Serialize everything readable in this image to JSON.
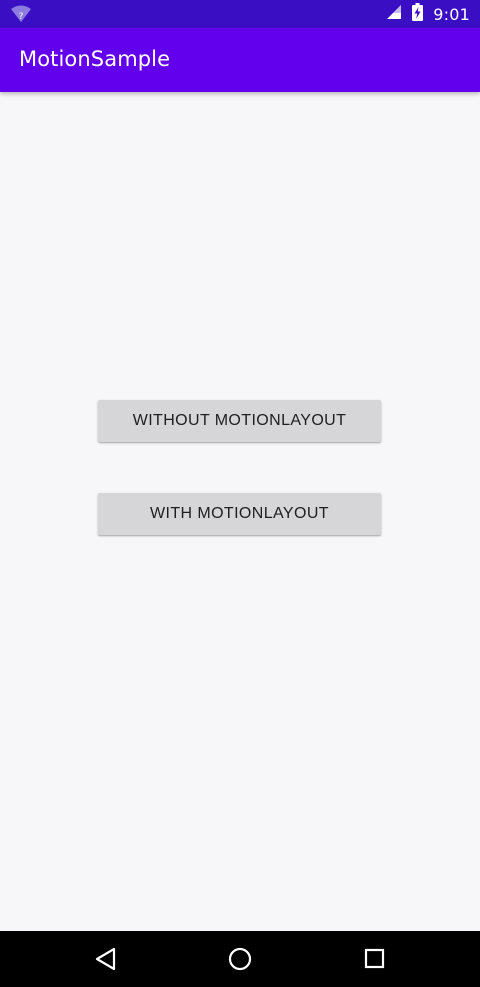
{
  "status_bar": {
    "time": "9:01",
    "icons": [
      "wifi-icon",
      "cell-signal-icon",
      "battery-charging-icon"
    ],
    "wifi_badge": "?",
    "background": "#3a0fc4"
  },
  "app_bar": {
    "title": "MotionSample",
    "background": "#6200ee"
  },
  "main": {
    "buttons": [
      {
        "label": "WITHOUT MOTIONLAYOUT"
      },
      {
        "label": "WITH MOTIONLAYOUT"
      }
    ],
    "background": "#f7f6f8",
    "button_color": "#d6d5d7"
  },
  "nav_bar": {
    "icons": [
      "back-icon",
      "home-icon",
      "recents-icon"
    ],
    "background": "#000000"
  }
}
